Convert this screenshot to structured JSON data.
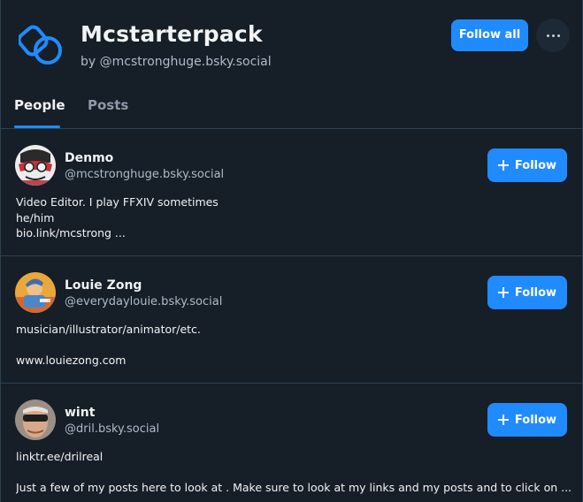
{
  "header": {
    "title": "Mcstarterpack",
    "byline": "by @mcstronghuge.bsky.social",
    "follow_all_label": "Follow all"
  },
  "tabs": [
    {
      "label": "People",
      "active": true
    },
    {
      "label": "Posts",
      "active": false
    }
  ],
  "people": [
    {
      "name": "Denmo",
      "handle": "@mcstronghuge.bsky.social",
      "follow_label": "Follow",
      "bio_lines": [
        "Video Editor. I play FFXIV sometimes",
        "he/him",
        "bio.link/mcstrong ..."
      ]
    },
    {
      "name": "Louie Zong",
      "handle": "@everydaylouie.bsky.social",
      "follow_label": "Follow",
      "bio_lines": [
        "musician/illustrator/animator/etc.",
        "",
        "www.louiezong.com"
      ]
    },
    {
      "name": "wint",
      "handle": "@dril.bsky.social",
      "follow_label": "Follow",
      "bio_lines": [
        "linktr.ee/drilreal",
        "",
        "Just a few of my posts here to look at . Make sure to look at my links and my posts and to click on ..."
      ]
    }
  ],
  "colors": {
    "background": "#161e27",
    "accent": "#208bfe",
    "border": "#2e4052",
    "muted_text": "#aebbc9"
  },
  "icons": {
    "pack": "starter-pack-icon",
    "more": "ellipsis-icon",
    "follow": "plus-icon"
  }
}
